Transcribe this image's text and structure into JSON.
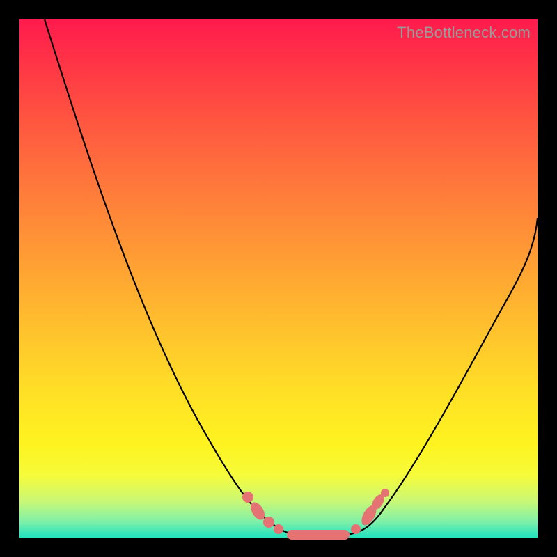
{
  "watermark": "TheBottleneck.com",
  "colors": {
    "page_bg": "#000000",
    "gradient_top": "#ff1a4d",
    "gradient_bottom": "#24e3bd",
    "curve": "#000000",
    "markers": "#e57373",
    "watermark": "#9a9a9a"
  },
  "chart_data": {
    "type": "line",
    "title": "",
    "xlabel": "",
    "ylabel": "",
    "xlim": [
      0,
      100
    ],
    "ylim": [
      0,
      100
    ],
    "grid": false,
    "series": [
      {
        "name": "curve",
        "x": [
          5,
          8,
          12,
          16,
          20,
          24,
          28,
          32,
          36,
          40,
          44,
          47,
          49,
          51,
          54,
          57,
          60,
          63,
          66,
          70,
          74,
          78,
          82,
          86,
          90,
          95,
          100
        ],
        "y": [
          100,
          90,
          80,
          70,
          60,
          51,
          42,
          34,
          27,
          20,
          14,
          9,
          6,
          3,
          1,
          0,
          0,
          0,
          1,
          4,
          9,
          17,
          26,
          36,
          46,
          55,
          62
        ]
      }
    ],
    "annotations": {
      "markers_on_curve_x_positions": [
        44,
        46,
        48,
        50,
        53,
        56,
        59,
        62,
        64,
        66
      ],
      "flat_valley_x_range": [
        53,
        63
      ]
    }
  }
}
